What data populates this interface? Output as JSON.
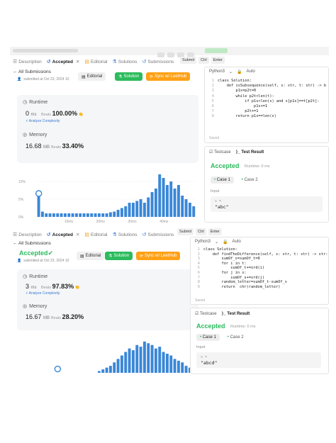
{
  "shot1": {
    "tabs": [
      {
        "label": "Description"
      },
      {
        "label": "Accepted"
      },
      {
        "label": "Editorial"
      },
      {
        "label": "Solutions"
      },
      {
        "label": "Submissions"
      }
    ],
    "back_label": "All Submissions",
    "submitted": "submitted at Oct 23, 2024 10",
    "buttons": {
      "editorial": "Editorial",
      "solution": "Solution",
      "sync": "Sync w/ LeetHub"
    },
    "runtime": {
      "title": "Runtime",
      "value": "0",
      "unit": "ms",
      "beats_label": "Beats",
      "beats_value": "100.00%",
      "analyze": "Analyze Complexity"
    },
    "memory": {
      "title": "Memory",
      "value": "16.68",
      "unit": "MB",
      "beats_label": "Beats",
      "beats_value": "33.40%"
    },
    "run": {
      "submit": "Submit",
      "ctrl": "Ctrl",
      "enter": "Enter"
    },
    "editor": {
      "language": "Python3",
      "mode": "Auto",
      "saved": "Saved"
    },
    "code_lines": [
      "class Solution:",
      "    def isSubsequence(self, s: str, t: str) -> b",
      "        p1s=p2t=0",
      "        while p2t<len(t):",
      "            if p1s<len(s) and s[p1s]==t[p2t]:",
      "                p1s+=1",
      "            p2t+=1",
      "        return p1s==len(s)"
    ],
    "testcase": {
      "tab1": "Testcase",
      "tab2": "Test Result",
      "result": "Accepted",
      "runtime": "Runtime: 0 ms",
      "case1": "Case 1",
      "case2": "Case 2",
      "input_label": "Input",
      "input_var": "s =",
      "input_value": "\"abc\""
    },
    "chart_data": {
      "type": "bar",
      "ylabels": [
        "10%",
        "5%",
        "0%"
      ],
      "xlabels": [
        "10ms",
        "20ms",
        "30ms",
        "40ms"
      ],
      "values": [
        6,
        1.5,
        1,
        1,
        1,
        1,
        1,
        1,
        1,
        1,
        1,
        1,
        1,
        1,
        1,
        1,
        1,
        1,
        1,
        1.3,
        1.5,
        2,
        2.5,
        3,
        4,
        4,
        4.5,
        5,
        4,
        5.5,
        7,
        8,
        12,
        11,
        9,
        10,
        8,
        9,
        6,
        5,
        4,
        3
      ],
      "ylim": [
        0,
        14
      ],
      "highlight_index": 0
    }
  },
  "shot2": {
    "tabs": [
      {
        "label": "Description"
      },
      {
        "label": "Accepted"
      },
      {
        "label": "Editorial"
      },
      {
        "label": "Solutions"
      },
      {
        "label": "Submissions"
      }
    ],
    "back_label": "All Submissions",
    "status": "Accepted",
    "submitted": "submitted at Oct 23, 2024 10",
    "buttons": {
      "editorial": "Editorial",
      "solution": "Solution",
      "sync": "Sync w/ LeetHub"
    },
    "runtime": {
      "title": "Runtime",
      "value": "3",
      "unit": "ms",
      "beats_label": "Beats",
      "beats_value": "97.83%",
      "analyze": "Analyze Complexity"
    },
    "memory": {
      "title": "Memory",
      "value": "16.67",
      "unit": "MB",
      "beats_label": "Beats",
      "beats_value": "28.20%"
    },
    "run": {
      "submit": "Submit",
      "ctrl": "Ctrl",
      "enter": "Enter"
    },
    "editor": {
      "language": "Python3",
      "mode": "Auto",
      "saved": "Saved"
    },
    "code_lines": [
      "class Solution:",
      "    def findTheDifference(self, s: str, t: str) -> str:",
      "        sumOf_s=sumOf_t=0",
      "        for i in t:",
      "            sumOf_t+=ord(i)",
      "        for j in s:",
      "            sumOf_s+=ord(j)",
      "        random_letter=sumOf_t-sumOf_s",
      "        return  chr(random_letter)"
    ],
    "testcase": {
      "tab1": "Testcase",
      "tab2": "Test Result",
      "result": "Accepted",
      "runtime": "Runtime: 0 ms",
      "case1": "Case 1",
      "case2": "Case 2",
      "input_label": "Input",
      "input_var": "s =",
      "input_value": "\"abcd\""
    },
    "chart_data": {
      "type": "bar",
      "values": [
        0,
        0,
        0,
        0,
        0,
        0,
        0,
        0,
        0,
        0,
        0,
        0,
        0,
        0,
        0,
        0,
        0.5,
        1,
        1.5,
        2,
        3,
        4,
        5,
        6,
        7,
        6.5,
        8,
        7.5,
        9,
        8.5,
        8,
        7,
        7.5,
        6,
        5.5,
        5,
        4,
        3.5,
        3,
        2,
        1.5,
        1
      ],
      "ylim": [
        0,
        11
      ],
      "highlight_index": 5
    }
  },
  "colors": {
    "green": "#2cbb5d",
    "orange": "#ffa116",
    "bar": "#3a87d8",
    "accent": "#3a7bd5"
  }
}
